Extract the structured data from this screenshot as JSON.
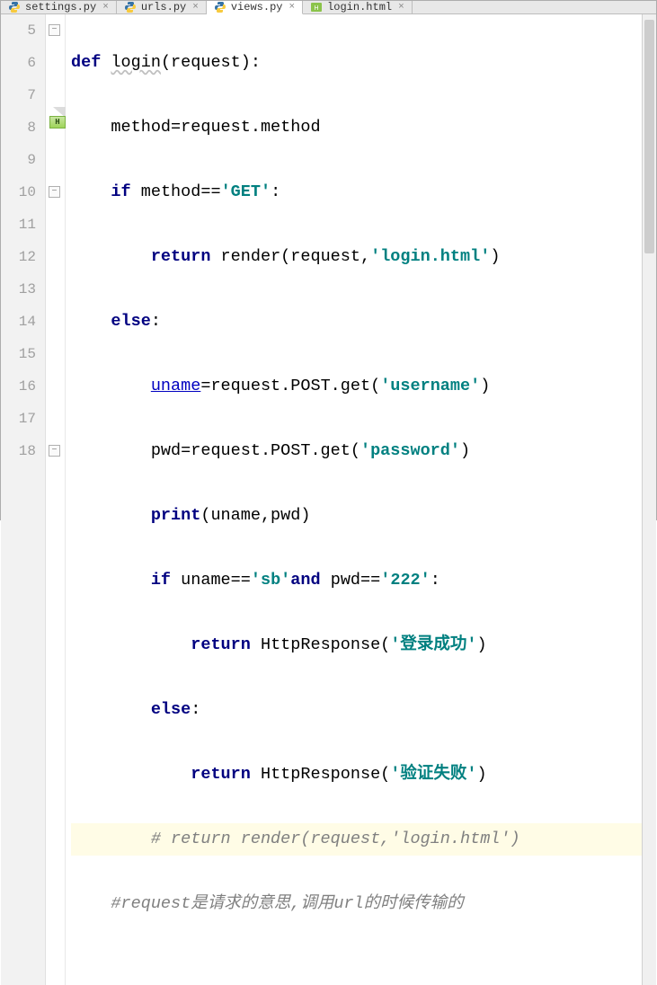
{
  "tabs": [
    {
      "label": "settings.py",
      "type": "py",
      "active": false
    },
    {
      "label": "urls.py",
      "type": "py",
      "active": false
    },
    {
      "label": "views.py",
      "type": "py",
      "active": true
    },
    {
      "label": "login.html",
      "type": "html",
      "active": false
    }
  ],
  "line_numbers": [
    "5",
    "6",
    "7",
    "8",
    "9",
    "10",
    "11",
    "12",
    "13",
    "14",
    "15",
    "16",
    "17",
    "18"
  ],
  "badge": "H",
  "code": {
    "l5": {
      "kw1": "def",
      "fn": "login",
      "rest": "(request):"
    },
    "l6": {
      "text": "method=request.method"
    },
    "l7": {
      "kw": "if",
      "mid": " method==",
      "str": "'GET'",
      "tail": ":"
    },
    "l8": {
      "kw": "return",
      "mid": " render(request,",
      "str": "'login.html'",
      "tail": ")"
    },
    "l9": {
      "kw": "else",
      "tail": ":"
    },
    "l10": {
      "var": "uname",
      "mid": "=request.POST.get(",
      "str": "'username'",
      "tail": ")"
    },
    "l11": {
      "pre": "pwd=request.POST.get(",
      "str": "'password'",
      "tail": ")"
    },
    "l12": {
      "kw": "print",
      "rest": "(uname,pwd)"
    },
    "l13": {
      "kw": "if",
      "mid1": " uname==",
      "str1": "'sb'",
      "kw2": "and",
      "mid2": " pwd==",
      "str2": "'222'",
      "tail": ":"
    },
    "l14": {
      "kw": "return",
      "mid": " HttpResponse(",
      "str": "'登录成功'",
      "tail": ")"
    },
    "l15": {
      "kw": "else",
      "tail": ":"
    },
    "l16": {
      "kw": "return",
      "mid": " HttpResponse(",
      "str": "'验证失败'",
      "tail": ")"
    },
    "l17": {
      "cmt": "# return render(request,'login.html')"
    },
    "l18": {
      "cmt": "#request是请求的意思,调用url的时候传输的"
    }
  }
}
